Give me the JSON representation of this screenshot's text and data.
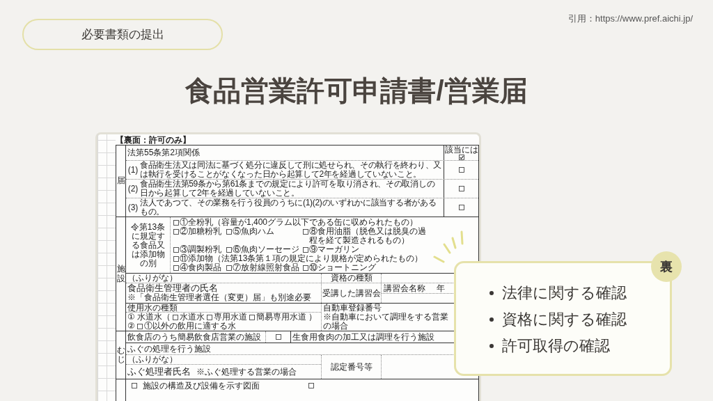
{
  "header": {
    "section_label": "必要書類の提出",
    "citation": "引用：https://www.pref.aichi.jp/"
  },
  "title": "食品営業許可申請書/営業届",
  "document": {
    "heading": "【裏面：許可のみ】",
    "disqualification": {
      "side_label": "届",
      "heading": "法第55条第2項関係",
      "applicable": {
        "label": "該当には",
        "checked": true
      },
      "items": [
        {
          "number": "(1)",
          "text": "食品衛生法又は同法に基づく処分に違反して刑に処せられ、その執行を終わり、又は執行を受けることがなくなった日から起算して2年を経過していないこと。",
          "checked": false
        },
        {
          "number": "(2)",
          "text": "食品衛生法第59条から第61条までの規定により許可を取り消され、その取消しの日から起算して2年を経過していないこと。",
          "checked": false
        },
        {
          "number": "(3)",
          "text": "法人であつて、その業務を行う役員のうちに(1)(2)のいずれかに該当する者があるもの。",
          "checked": false
        }
      ]
    },
    "facility": {
      "side_label": "施設",
      "food_types": {
        "label": "令第13条に規定する食品又は添加物の別",
        "rows": [
          {
            "options": [
              {
                "label": "①全粉乳（容量が1,400グラム以下である缶に収められたもの）",
                "checked": false
              }
            ]
          },
          {
            "options": [
              {
                "label": "②加糖粉乳",
                "checked": false
              },
              {
                "label": "⑤魚肉ハム",
                "checked": false
              },
              {
                "label": "⑧食用油脂（脱色又は脱臭の過程を経て製造されるもの）",
                "checked": false
              }
            ]
          },
          {
            "options": [
              {
                "label": "③調製粉乳",
                "checked": false
              },
              {
                "label": "⑥魚肉ソーセージ",
                "checked": false
              },
              {
                "label": "⑨マーガリン",
                "checked": false
              }
            ]
          },
          {
            "options": [
              {
                "label": "⑪添加物（法第13条第１項の規定により規格が定められたもの）",
                "checked": false
              }
            ]
          },
          {
            "options": [
              {
                "label": "④食肉製品",
                "checked": false
              },
              {
                "label": "⑦放射線照射食品",
                "checked": false
              },
              {
                "label": "⑩ショートニング",
                "checked": false
              }
            ]
          }
        ]
      },
      "furigana": "（ふりがな）",
      "manager_name_label": "食品衛生管理者の氏名",
      "manager_note": "※「食品衛生管理者選任（変更）届」も別途必要",
      "qualification_label": "資格の種類",
      "course_label": "受講した講習会",
      "course_name_label": "講習会名称",
      "year_label": "年",
      "water": {
        "label": "使用水の種類",
        "rows": [
          {
            "number": "①",
            "prefix": "水道水（",
            "options": [
              {
                "label": "水道水",
                "checked": false
              },
              {
                "label": "専用水道",
                "checked": false
              },
              {
                "label": "簡易専用水道",
                "checked": false
              }
            ],
            "suffix": "）"
          },
          {
            "number": "②",
            "options": [
              {
                "label": "①以外の飲用に適する水",
                "checked": false
              }
            ]
          }
        ]
      },
      "vehicle_label": "自動車登録番号",
      "vehicle_note": "※自動車において調理をする営業の場合"
    },
    "special": {
      "side_label": "むじ",
      "simple_restaurant": {
        "label": "飲食店のうち簡易飲食店営業の施設",
        "checked": false
      },
      "raw_meat_label": "生食用食肉の加工又は調理を行う施設",
      "fugu_facility_label": "ふぐの処理を行う施設",
      "furigana": "（ふりがな）",
      "fugu_handler_label": "ふぐ処理者氏名",
      "fugu_handler_note": "※ふぐ処理する営業の場合",
      "certification_label": "認定番号等"
    },
    "attachments": [
      {
        "label": "施設の構造及び設備を示す図面",
        "checked": false
      },
      {
        "checked": false
      }
    ]
  },
  "summary_card": {
    "badge": "裏",
    "items": [
      "法律に関する確認",
      "資格に関する確認",
      "許可取得の確認"
    ]
  }
}
